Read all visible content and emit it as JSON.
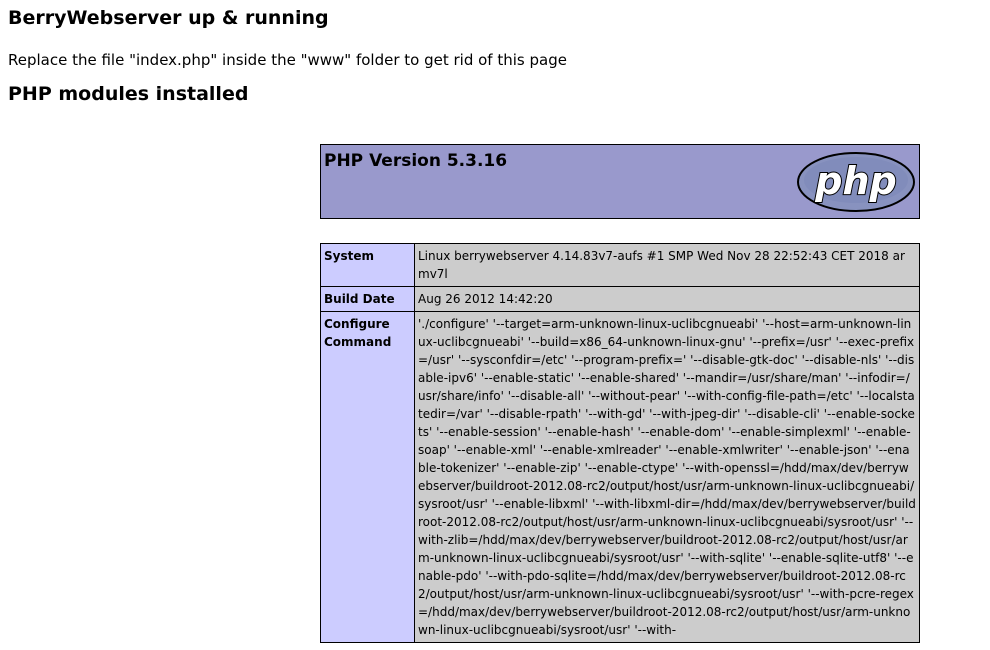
{
  "page": {
    "title": "BerryWebserver up & running",
    "intro": "Replace the file \"index.php\" inside the \"www\" folder to get rid of this page",
    "modules_heading": "PHP modules installed"
  },
  "phpinfo": {
    "version_title": "PHP Version 5.3.16",
    "logo_text": "php",
    "rows": [
      {
        "label": "System",
        "value": "Linux berrywebserver 4.14.83v7-aufs #1 SMP Wed Nov 28 22:52:43 CET 2018 armv7l"
      },
      {
        "label": "Build Date",
        "value": "Aug 26 2012 14:42:20"
      },
      {
        "label": "Configure Command",
        "value": "'./configure' '--target=arm-unknown-linux-uclibcgnueabi' '--host=arm-unknown-linux-uclibcgnueabi' '--build=x86_64-unknown-linux-gnu' '--prefix=/usr' '--exec-prefix=/usr' '--sysconfdir=/etc' '--program-prefix=' '--disable-gtk-doc' '--disable-nls' '--disable-ipv6' '--enable-static' '--enable-shared' '--mandir=/usr/share/man' '--infodir=/usr/share/info' '--disable-all' '--without-pear' '--with-config-file-path=/etc' '--localstatedir=/var' '--disable-rpath' '--with-gd' '--with-jpeg-dir' '--disable-cli' '--enable-sockets' '--enable-session' '--enable-hash' '--enable-dom' '--enable-simplexml' '--enable-soap' '--enable-xml' '--enable-xmlreader' '--enable-xmlwriter' '--enable-json' '--enable-tokenizer' '--enable-zip' '--enable-ctype' '--with-openssl=/hdd/max/dev/berrywebserver/buildroot-2012.08-rc2/output/host/usr/arm-unknown-linux-uclibcgnueabi/sysroot/usr' '--enable-libxml' '--with-libxml-dir=/hdd/max/dev/berrywebserver/buildroot-2012.08-rc2/output/host/usr/arm-unknown-linux-uclibcgnueabi/sysroot/usr' '--with-zlib=/hdd/max/dev/berrywebserver/buildroot-2012.08-rc2/output/host/usr/arm-unknown-linux-uclibcgnueabi/sysroot/usr' '--with-sqlite' '--enable-sqlite-utf8' '--enable-pdo' '--with-pdo-sqlite=/hdd/max/dev/berrywebserver/buildroot-2012.08-rc2/output/host/usr/arm-unknown-linux-uclibcgnueabi/sysroot/usr' '--with-pcre-regex=/hdd/max/dev/berrywebserver/buildroot-2012.08-rc2/output/host/usr/arm-unknown-linux-uclibcgnueabi/sysroot/usr' '--with-"
      }
    ]
  },
  "colors": {
    "header_bg": "#9999cc",
    "label_bg": "#ccccff",
    "value_bg": "#cccccc",
    "logo_fill": "#8892bf",
    "logo_outline": "#000000"
  }
}
